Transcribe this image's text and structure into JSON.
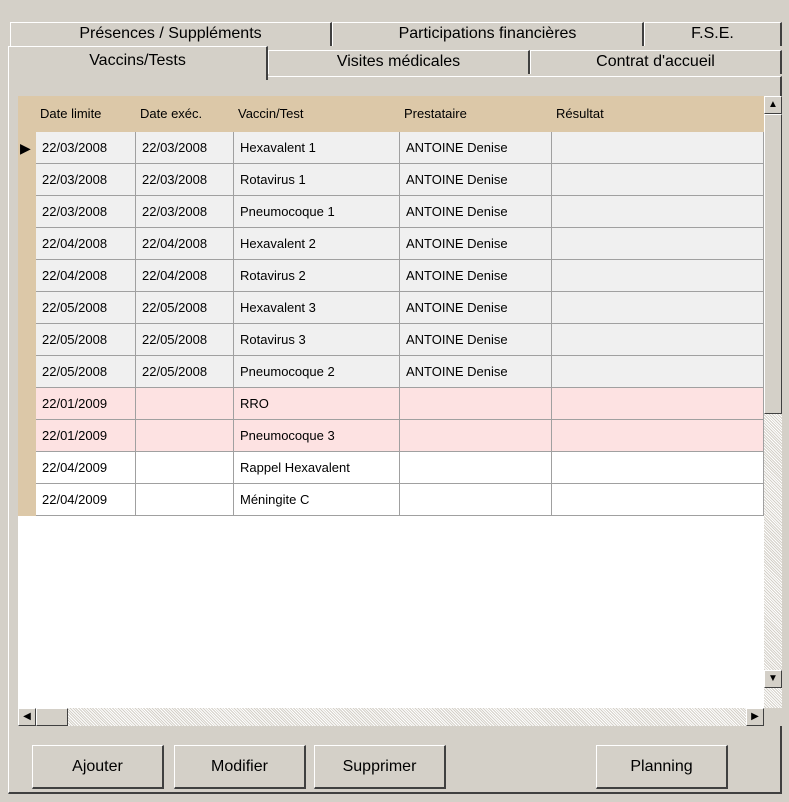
{
  "tabs_back": [
    "Présences / Suppléments",
    "Participations financières",
    "F.S.E."
  ],
  "tabs_front": [
    "Vaccins/Tests",
    "Visites médicales",
    "Contrat d'accueil"
  ],
  "active_tab": "Vaccins/Tests",
  "columns": [
    "Date limite",
    "Date exéc.",
    "Vaccin/Test",
    "Prestataire",
    "Résultat"
  ],
  "rows": [
    {
      "date_limite": "22/03/2008",
      "date_exec": "22/03/2008",
      "vaccin": "Hexavalent 1",
      "prestataire": "ANTOINE Denise",
      "resultat": "",
      "status": "done"
    },
    {
      "date_limite": "22/03/2008",
      "date_exec": "22/03/2008",
      "vaccin": "Rotavirus 1",
      "prestataire": "ANTOINE Denise",
      "resultat": "",
      "status": "done"
    },
    {
      "date_limite": "22/03/2008",
      "date_exec": "22/03/2008",
      "vaccin": "Pneumocoque 1",
      "prestataire": "ANTOINE Denise",
      "resultat": "",
      "status": "done"
    },
    {
      "date_limite": "22/04/2008",
      "date_exec": "22/04/2008",
      "vaccin": "Hexavalent 2",
      "prestataire": "ANTOINE Denise",
      "resultat": "",
      "status": "done"
    },
    {
      "date_limite": "22/04/2008",
      "date_exec": "22/04/2008",
      "vaccin": "Rotavirus 2",
      "prestataire": "ANTOINE Denise",
      "resultat": "",
      "status": "done"
    },
    {
      "date_limite": "22/05/2008",
      "date_exec": "22/05/2008",
      "vaccin": "Hexavalent 3",
      "prestataire": "ANTOINE Denise",
      "resultat": "",
      "status": "done"
    },
    {
      "date_limite": "22/05/2008",
      "date_exec": "22/05/2008",
      "vaccin": "Rotavirus 3",
      "prestataire": "ANTOINE Denise",
      "resultat": "",
      "status": "done"
    },
    {
      "date_limite": "22/05/2008",
      "date_exec": "22/05/2008",
      "vaccin": "Pneumocoque 2",
      "prestataire": "ANTOINE Denise",
      "resultat": "",
      "status": "done"
    },
    {
      "date_limite": "22/01/2009",
      "date_exec": "",
      "vaccin": "RRO",
      "prestataire": "",
      "resultat": "",
      "status": "overdue"
    },
    {
      "date_limite": "22/01/2009",
      "date_exec": "",
      "vaccin": "Pneumocoque 3",
      "prestataire": "",
      "resultat": "",
      "status": "overdue"
    },
    {
      "date_limite": "22/04/2009",
      "date_exec": "",
      "vaccin": "Rappel Hexavalent",
      "prestataire": "",
      "resultat": "",
      "status": "pending"
    },
    {
      "date_limite": "22/04/2009",
      "date_exec": "",
      "vaccin": "Méningite C",
      "prestataire": "",
      "resultat": "",
      "status": "pending"
    }
  ],
  "status_colors": {
    "done": "#f0f0f0",
    "overdue": "#fde2e2",
    "pending": "#ffffff",
    "header": "#dcc8a8"
  },
  "buttons": {
    "ajouter": "Ajouter",
    "modifier": "Modifier",
    "supprimer": "Supprimer",
    "planning": "Planning"
  },
  "scroll_glyphs": {
    "up": "▲",
    "down": "▼",
    "left": "◀",
    "right": "▶",
    "current_row": "▶"
  }
}
